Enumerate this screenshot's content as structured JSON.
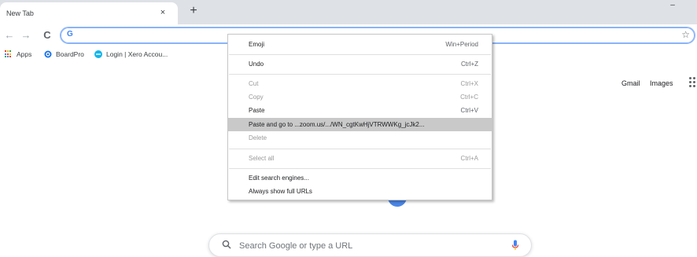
{
  "tab": {
    "title": "New Tab",
    "close_glyph": "×",
    "new_tab_glyph": "+"
  },
  "window": {
    "minimize_glyph": "–"
  },
  "toolbar": {
    "back_glyph": "←",
    "forward_glyph": "→",
    "reload_glyph": "C",
    "omnibox_icon": "G",
    "star_glyph": "☆"
  },
  "bookmarks": [
    {
      "label": "Apps",
      "icon": "apps-grid-icon"
    },
    {
      "label": "BoardPro",
      "icon": "boardpro-icon"
    },
    {
      "label": "Login | Xero Accou...",
      "icon": "xero-icon"
    }
  ],
  "ntp": {
    "gmail": "Gmail",
    "images": "Images",
    "search_placeholder": "Search Google or type a URL"
  },
  "context_menu": {
    "items": [
      {
        "label": "Emoji",
        "shortcut": "Win+Period",
        "disabled": false
      },
      {
        "label": "Undo",
        "shortcut": "Ctrl+Z",
        "disabled": false
      },
      {
        "label": "Cut",
        "shortcut": "Ctrl+X",
        "disabled": true
      },
      {
        "label": "Copy",
        "shortcut": "Ctrl+C",
        "disabled": true
      },
      {
        "label": "Paste",
        "shortcut": "Ctrl+V",
        "disabled": false
      },
      {
        "label": "Paste and go to ...zoom.us/.../WN_cgtKwHjVTRWWKg_jcJk2...",
        "shortcut": "",
        "disabled": false,
        "highlighted": true
      },
      {
        "label": "Delete",
        "shortcut": "",
        "disabled": true
      },
      {
        "label": "Select all",
        "shortcut": "Ctrl+A",
        "disabled": true
      },
      {
        "label": "Edit search engines...",
        "shortcut": "",
        "disabled": false
      },
      {
        "label": "Always show full URLs",
        "shortcut": "",
        "disabled": false
      }
    ]
  },
  "colors": {
    "accent": "#4285f4",
    "highlight": "#c9c9c9",
    "tabstrip": "#dee1e6"
  }
}
